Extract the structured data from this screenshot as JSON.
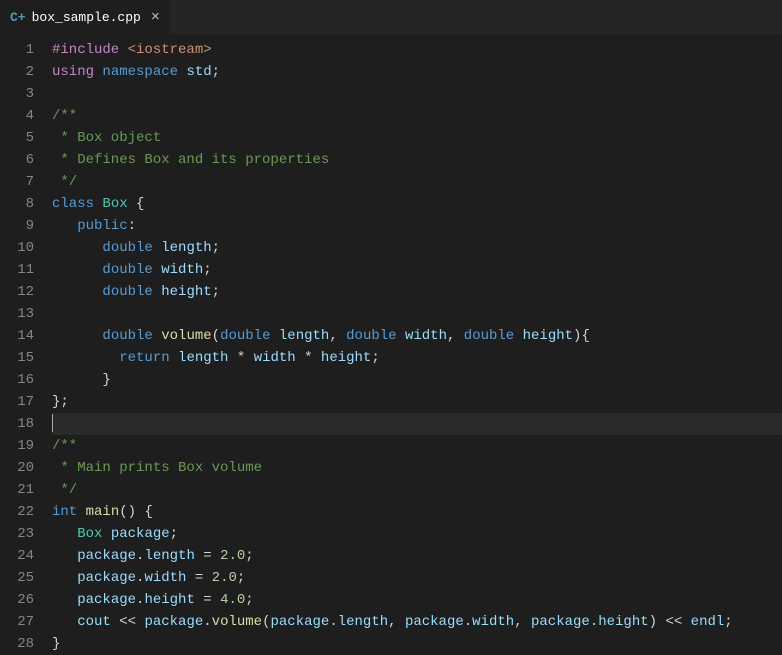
{
  "tab": {
    "icon_label": "C+",
    "filename": "box_sample.cpp",
    "close_glyph": "×"
  },
  "editor": {
    "current_line": 18,
    "lines": [
      {
        "n": 1,
        "tokens": [
          [
            "c-include",
            "#include"
          ],
          [
            "c-punct",
            " "
          ],
          [
            "c-string",
            "<iostream>"
          ]
        ]
      },
      {
        "n": 2,
        "tokens": [
          [
            "c-using",
            "using"
          ],
          [
            "c-punct",
            " "
          ],
          [
            "c-keyword",
            "namespace"
          ],
          [
            "c-punct",
            " "
          ],
          [
            "c-ident",
            "std"
          ],
          [
            "c-punct",
            ";"
          ]
        ]
      },
      {
        "n": 3,
        "tokens": []
      },
      {
        "n": 4,
        "tokens": [
          [
            "c-comment",
            "/**"
          ]
        ]
      },
      {
        "n": 5,
        "tokens": [
          [
            "c-comment",
            " * Box object"
          ]
        ]
      },
      {
        "n": 6,
        "tokens": [
          [
            "c-comment",
            " * Defines Box and its properties"
          ]
        ]
      },
      {
        "n": 7,
        "tokens": [
          [
            "c-comment",
            " */"
          ]
        ]
      },
      {
        "n": 8,
        "tokens": [
          [
            "c-keyword",
            "class"
          ],
          [
            "c-punct",
            " "
          ],
          [
            "c-class",
            "Box"
          ],
          [
            "c-punct",
            " {"
          ]
        ]
      },
      {
        "n": 9,
        "tokens": [
          [
            "c-punct",
            "   "
          ],
          [
            "c-keyword",
            "public"
          ],
          [
            "c-punct",
            ":"
          ]
        ]
      },
      {
        "n": 10,
        "tokens": [
          [
            "c-punct",
            "      "
          ],
          [
            "c-type",
            "double"
          ],
          [
            "c-punct",
            " "
          ],
          [
            "c-ident",
            "length"
          ],
          [
            "c-punct",
            ";"
          ]
        ]
      },
      {
        "n": 11,
        "tokens": [
          [
            "c-punct",
            "      "
          ],
          [
            "c-type",
            "double"
          ],
          [
            "c-punct",
            " "
          ],
          [
            "c-ident",
            "width"
          ],
          [
            "c-punct",
            ";"
          ]
        ]
      },
      {
        "n": 12,
        "tokens": [
          [
            "c-punct",
            "      "
          ],
          [
            "c-type",
            "double"
          ],
          [
            "c-punct",
            " "
          ],
          [
            "c-ident",
            "height"
          ],
          [
            "c-punct",
            ";"
          ]
        ]
      },
      {
        "n": 13,
        "tokens": []
      },
      {
        "n": 14,
        "tokens": [
          [
            "c-punct",
            "      "
          ],
          [
            "c-type",
            "double"
          ],
          [
            "c-punct",
            " "
          ],
          [
            "c-func",
            "volume"
          ],
          [
            "c-punct",
            "("
          ],
          [
            "c-type",
            "double"
          ],
          [
            "c-punct",
            " "
          ],
          [
            "c-ident",
            "length"
          ],
          [
            "c-punct",
            ", "
          ],
          [
            "c-type",
            "double"
          ],
          [
            "c-punct",
            " "
          ],
          [
            "c-ident",
            "width"
          ],
          [
            "c-punct",
            ", "
          ],
          [
            "c-type",
            "double"
          ],
          [
            "c-punct",
            " "
          ],
          [
            "c-ident",
            "height"
          ],
          [
            "c-punct",
            "){"
          ]
        ]
      },
      {
        "n": 15,
        "tokens": [
          [
            "c-punct",
            "        "
          ],
          [
            "c-keyword",
            "return"
          ],
          [
            "c-punct",
            " "
          ],
          [
            "c-ident",
            "length"
          ],
          [
            "c-punct",
            " "
          ],
          [
            "c-op",
            "*"
          ],
          [
            "c-punct",
            " "
          ],
          [
            "c-ident",
            "width"
          ],
          [
            "c-punct",
            " "
          ],
          [
            "c-op",
            "*"
          ],
          [
            "c-punct",
            " "
          ],
          [
            "c-ident",
            "height"
          ],
          [
            "c-punct",
            ";"
          ]
        ]
      },
      {
        "n": 16,
        "tokens": [
          [
            "c-punct",
            "      }"
          ]
        ]
      },
      {
        "n": 17,
        "tokens": [
          [
            "c-punct",
            "};"
          ]
        ]
      },
      {
        "n": 18,
        "tokens": []
      },
      {
        "n": 19,
        "tokens": [
          [
            "c-comment",
            "/**"
          ]
        ]
      },
      {
        "n": 20,
        "tokens": [
          [
            "c-comment",
            " * Main prints Box volume"
          ]
        ]
      },
      {
        "n": 21,
        "tokens": [
          [
            "c-comment",
            " */"
          ]
        ]
      },
      {
        "n": 22,
        "tokens": [
          [
            "c-type",
            "int"
          ],
          [
            "c-punct",
            " "
          ],
          [
            "c-func",
            "main"
          ],
          [
            "c-punct",
            "() {"
          ]
        ]
      },
      {
        "n": 23,
        "tokens": [
          [
            "c-punct",
            "   "
          ],
          [
            "c-class",
            "Box"
          ],
          [
            "c-punct",
            " "
          ],
          [
            "c-ident",
            "package"
          ],
          [
            "c-punct",
            ";"
          ]
        ]
      },
      {
        "n": 24,
        "tokens": [
          [
            "c-punct",
            "   "
          ],
          [
            "c-ident",
            "package"
          ],
          [
            "c-punct",
            "."
          ],
          [
            "c-ident",
            "length"
          ],
          [
            "c-punct",
            " = "
          ],
          [
            "c-number",
            "2.0"
          ],
          [
            "c-punct",
            ";"
          ]
        ]
      },
      {
        "n": 25,
        "tokens": [
          [
            "c-punct",
            "   "
          ],
          [
            "c-ident",
            "package"
          ],
          [
            "c-punct",
            "."
          ],
          [
            "c-ident",
            "width"
          ],
          [
            "c-punct",
            " = "
          ],
          [
            "c-number",
            "2.0"
          ],
          [
            "c-punct",
            ";"
          ]
        ]
      },
      {
        "n": 26,
        "tokens": [
          [
            "c-punct",
            "   "
          ],
          [
            "c-ident",
            "package"
          ],
          [
            "c-punct",
            "."
          ],
          [
            "c-ident",
            "height"
          ],
          [
            "c-punct",
            " = "
          ],
          [
            "c-number",
            "4.0"
          ],
          [
            "c-punct",
            ";"
          ]
        ]
      },
      {
        "n": 27,
        "tokens": [
          [
            "c-punct",
            "   "
          ],
          [
            "c-ident",
            "cout"
          ],
          [
            "c-punct",
            " "
          ],
          [
            "c-op",
            "<<"
          ],
          [
            "c-punct",
            " "
          ],
          [
            "c-ident",
            "package"
          ],
          [
            "c-punct",
            "."
          ],
          [
            "c-func",
            "volume"
          ],
          [
            "c-punct",
            "("
          ],
          [
            "c-ident",
            "package"
          ],
          [
            "c-punct",
            "."
          ],
          [
            "c-ident",
            "length"
          ],
          [
            "c-punct",
            ", "
          ],
          [
            "c-ident",
            "package"
          ],
          [
            "c-punct",
            "."
          ],
          [
            "c-ident",
            "width"
          ],
          [
            "c-punct",
            ", "
          ],
          [
            "c-ident",
            "package"
          ],
          [
            "c-punct",
            "."
          ],
          [
            "c-ident",
            "height"
          ],
          [
            "c-punct",
            ") "
          ],
          [
            "c-op",
            "<<"
          ],
          [
            "c-punct",
            " "
          ],
          [
            "c-ident",
            "endl"
          ],
          [
            "c-punct",
            ";"
          ]
        ]
      },
      {
        "n": 28,
        "tokens": [
          [
            "c-punct",
            "}"
          ]
        ]
      }
    ]
  }
}
